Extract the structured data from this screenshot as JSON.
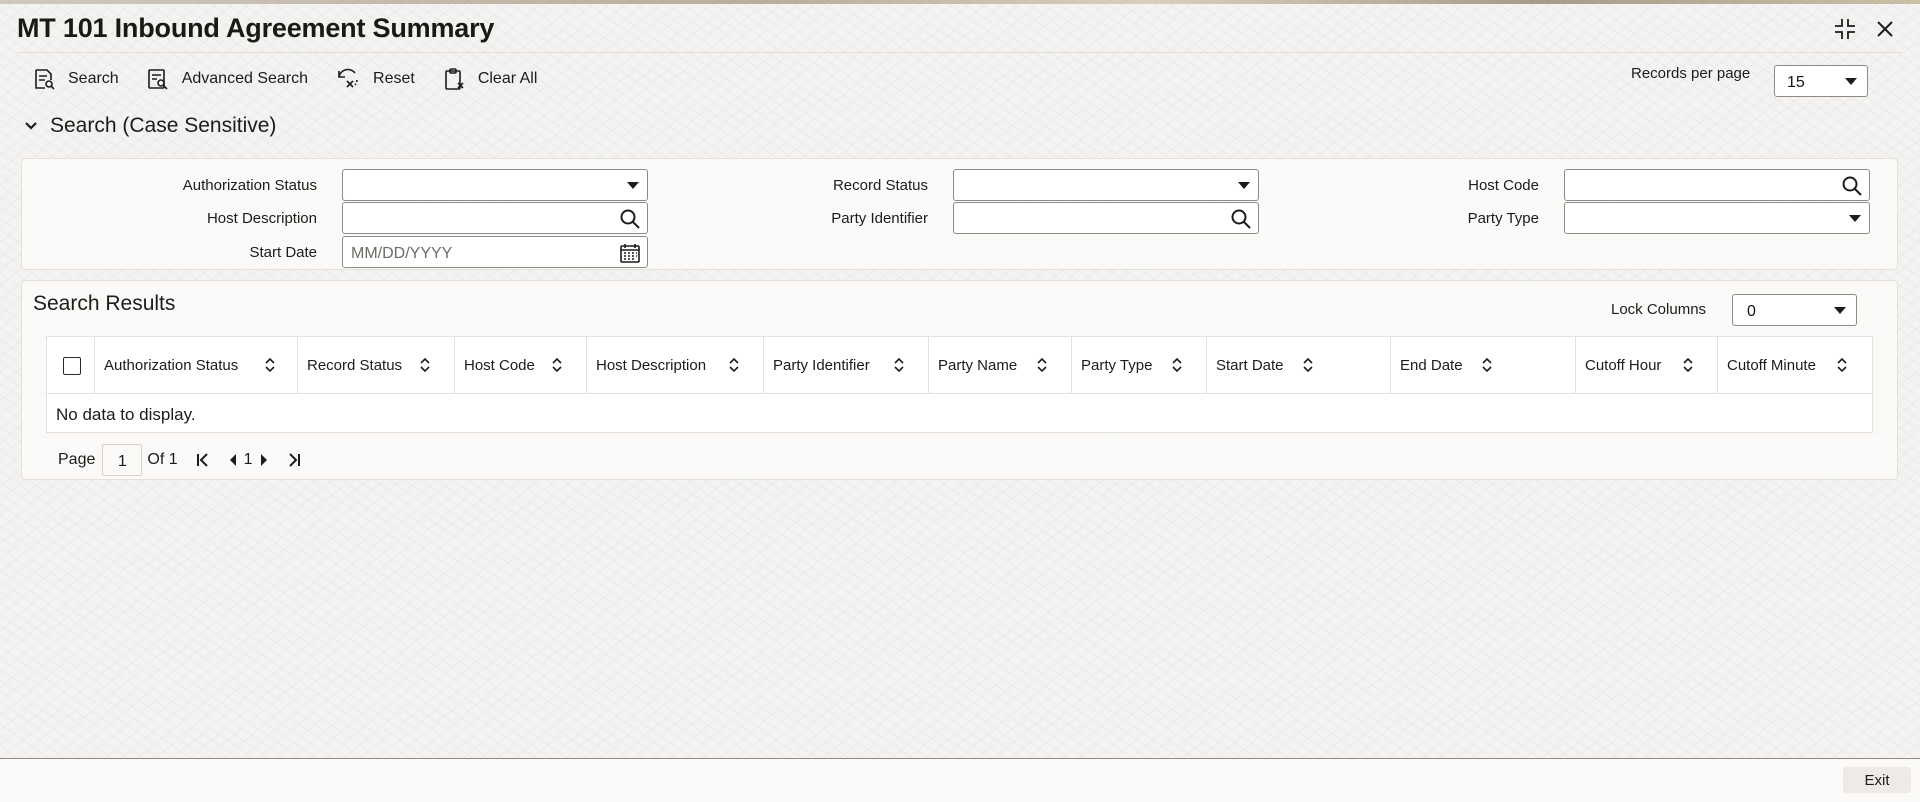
{
  "window": {
    "title": "MT 101 Inbound Agreement Summary",
    "maximize_icon": "expand-corners-icon",
    "close_icon": "close-icon"
  },
  "toolbar": {
    "search_label": "Search",
    "advanced_search_label": "Advanced Search",
    "reset_label": "Reset",
    "clear_all_label": "Clear All"
  },
  "records_per_page": {
    "label": "Records per page",
    "value": "15"
  },
  "search_section": {
    "title": "Search (Case Sensitive)",
    "fields": {
      "authorization_status": {
        "label": "Authorization Status",
        "value": ""
      },
      "record_status": {
        "label": "Record Status",
        "value": ""
      },
      "host_code": {
        "label": "Host Code",
        "value": ""
      },
      "host_description": {
        "label": "Host Description",
        "value": ""
      },
      "party_identifier": {
        "label": "Party Identifier",
        "value": ""
      },
      "party_type": {
        "label": "Party Type",
        "value": ""
      },
      "start_date": {
        "label": "Start Date",
        "placeholder": "MM/DD/YYYY",
        "value": ""
      }
    }
  },
  "results": {
    "title": "Search Results",
    "lock_columns": {
      "label": "Lock Columns",
      "value": "0"
    },
    "columns": [
      "Authorization Status",
      "Record Status",
      "Host Code",
      "Host Description",
      "Party Identifier",
      "Party Name",
      "Party Type",
      "Start Date",
      "End Date",
      "Cutoff Hour",
      "Cutoff Minute"
    ],
    "empty_message": "No data to display."
  },
  "pagination": {
    "page_label": "Page",
    "current_page": "1",
    "of_label": "Of 1",
    "page_number": "1"
  },
  "footer": {
    "exit_label": "Exit"
  }
}
